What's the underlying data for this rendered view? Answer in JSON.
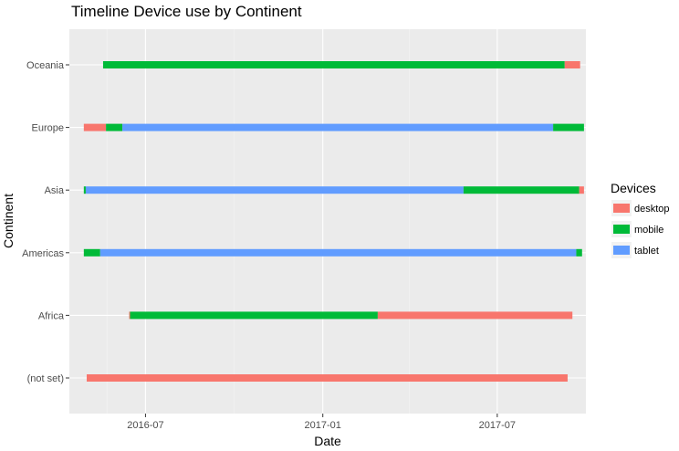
{
  "chart_data": {
    "type": "timeline",
    "title": "Timeline Device use by Continent",
    "xlabel": "Date",
    "ylabel": "Continent",
    "x_scale": "date",
    "xlim": [
      "2016-04-13",
      "2017-10-01"
    ],
    "x_ticks": [
      {
        "date": "2016-07-01",
        "label": "2016-07"
      },
      {
        "date": "2017-01-01",
        "label": "2017-01"
      },
      {
        "date": "2017-07-01",
        "label": "2017-07"
      }
    ],
    "categories": [
      "(not set)",
      "Africa",
      "Americas",
      "Asia",
      "Europe",
      "Oceania"
    ],
    "grid": true,
    "legend_position": "right",
    "legend_title": "Devices",
    "series": [
      {
        "name": "desktop",
        "color": "#F8766D"
      },
      {
        "name": "mobile",
        "color": "#00BA38"
      },
      {
        "name": "tablet",
        "color": "#619CFF"
      }
    ],
    "segments": [
      {
        "category": "(not set)",
        "device": "desktop",
        "start": "2016-05-01",
        "end": "2017-09-12"
      },
      {
        "category": "Africa",
        "device": "desktop",
        "start": "2016-06-14",
        "end": "2016-06-15"
      },
      {
        "category": "Africa",
        "device": "mobile",
        "start": "2016-06-15",
        "end": "2017-02-27"
      },
      {
        "category": "Africa",
        "device": "desktop",
        "start": "2017-02-27",
        "end": "2017-09-17"
      },
      {
        "category": "Americas",
        "device": "mobile",
        "start": "2016-04-28",
        "end": "2016-05-15"
      },
      {
        "category": "Americas",
        "device": "tablet",
        "start": "2016-05-15",
        "end": "2017-09-21"
      },
      {
        "category": "Americas",
        "device": "mobile",
        "start": "2017-09-21",
        "end": "2017-09-27"
      },
      {
        "category": "Asia",
        "device": "mobile",
        "start": "2016-04-28",
        "end": "2016-04-30"
      },
      {
        "category": "Asia",
        "device": "tablet",
        "start": "2016-04-30",
        "end": "2017-05-27"
      },
      {
        "category": "Asia",
        "device": "mobile",
        "start": "2017-05-27",
        "end": "2017-09-24"
      },
      {
        "category": "Asia",
        "device": "desktop",
        "start": "2017-09-24",
        "end": "2017-09-29"
      },
      {
        "category": "Europe",
        "device": "desktop",
        "start": "2016-04-28",
        "end": "2016-05-21"
      },
      {
        "category": "Europe",
        "device": "mobile",
        "start": "2016-05-21",
        "end": "2016-06-07"
      },
      {
        "category": "Europe",
        "device": "tablet",
        "start": "2016-06-07",
        "end": "2017-08-28"
      },
      {
        "category": "Europe",
        "device": "mobile",
        "start": "2017-08-28",
        "end": "2017-09-29"
      },
      {
        "category": "Oceania",
        "device": "mobile",
        "start": "2016-05-18",
        "end": "2017-09-09"
      },
      {
        "category": "Oceania",
        "device": "desktop",
        "start": "2017-09-09",
        "end": "2017-09-25"
      }
    ]
  }
}
